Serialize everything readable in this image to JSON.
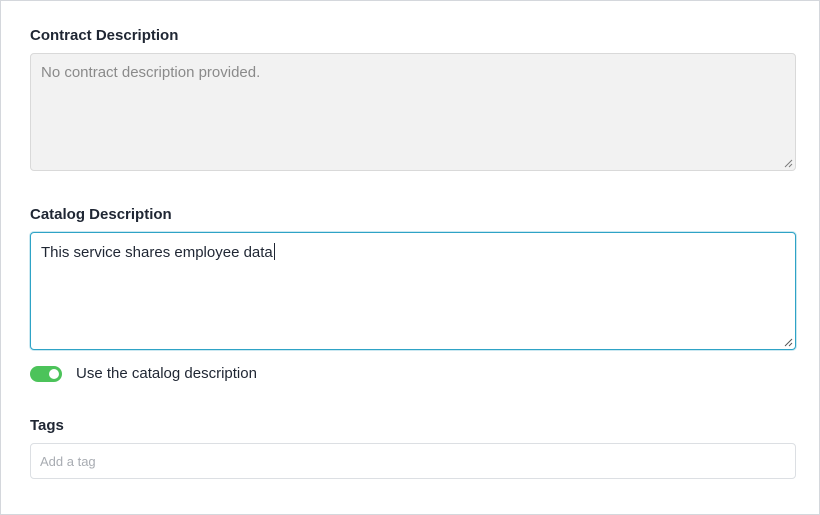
{
  "contract": {
    "label": "Contract Description",
    "value": "No contract description provided."
  },
  "catalog": {
    "label": "Catalog Description",
    "value": "This service shares employee data"
  },
  "toggle": {
    "label": "Use the catalog description",
    "on": true,
    "color": "#4cc35a"
  },
  "tags": {
    "label": "Tags",
    "placeholder": "Add a tag"
  },
  "colors": {
    "focus_border": "#2ea3c6",
    "disabled_bg": "#f2f2f2"
  }
}
